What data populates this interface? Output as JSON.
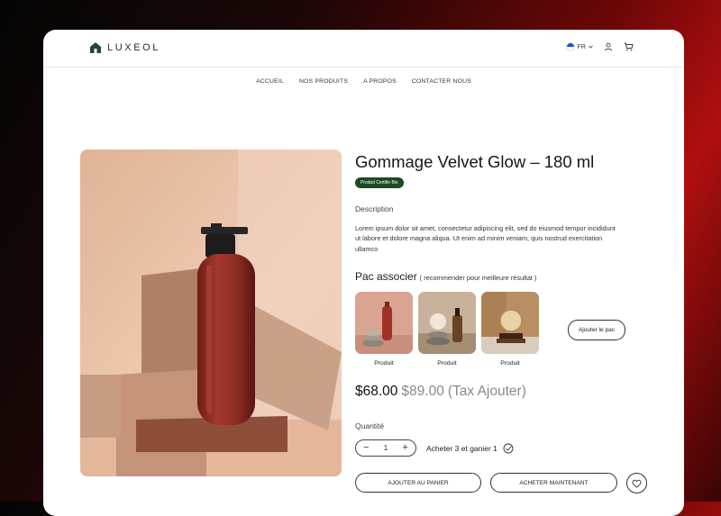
{
  "header": {
    "brand": "LUXEOL",
    "language": "FR",
    "icons": [
      "logo-icon",
      "user-icon",
      "cart-icon"
    ]
  },
  "nav": {
    "items": [
      "ACCUEIL",
      "NOS PRODUITS",
      "A PROPOS",
      "CONTACTER NOUS"
    ]
  },
  "product": {
    "title": "Gommage Velvet Glow – 180 ml",
    "badge": "Produit Certifie Bio",
    "description_label": "Description",
    "description": "Lorem ipsum dolor sit amet, consectetur adipiscing elit, sed do eiusmod tempor incididunt ut labore et dolore magna aliqua. Ut enim ad minim veniam, quis nostrud exercitation ullamco"
  },
  "pack": {
    "title": "Pac associer",
    "note": "( recommender pour meilleure résultat )",
    "items": [
      {
        "label": "Produit"
      },
      {
        "label": "Produit"
      },
      {
        "label": "Produit"
      }
    ],
    "add_button": "Ajouter le pac"
  },
  "pricing": {
    "price": "$68.00",
    "old_price": "$89.00",
    "tax": "(Tax Ajouter)"
  },
  "quantity": {
    "label": "Quantité",
    "value": "1",
    "minus": "−",
    "plus": "+",
    "offer": "Acheter 3 et ganier 1"
  },
  "actions": {
    "add_to_cart": "AJOUTER AU  PANIER",
    "buy_now": "ACHETER MAINTENANT"
  },
  "colors": {
    "accent_green": "#1d4a22",
    "bottle_red": "#8c2a22",
    "background_red": "#b00f0f"
  }
}
